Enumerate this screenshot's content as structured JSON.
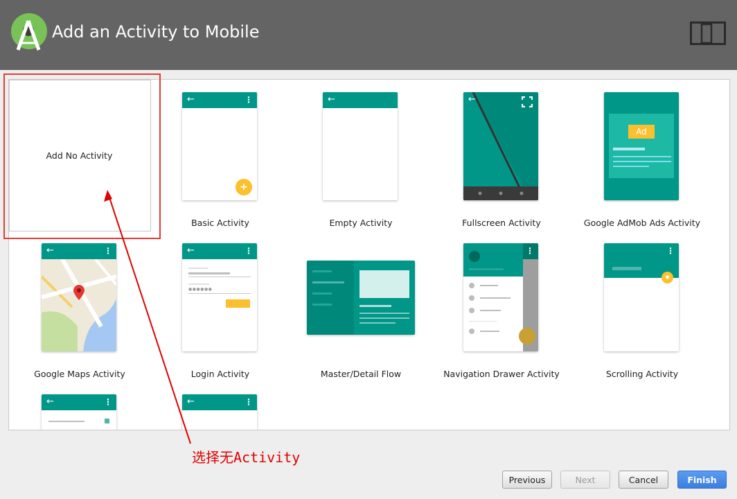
{
  "window": {
    "title": "Add an Activity to Mobile",
    "logo_icon": "android-studio-logo-icon",
    "device_icon": "tablet-phone-icon"
  },
  "templates": [
    {
      "label": "Add No Activity",
      "selected": true
    },
    {
      "label": "Basic Activity"
    },
    {
      "label": "Empty Activity"
    },
    {
      "label": "Fullscreen Activity"
    },
    {
      "label": "Google AdMob Ads Activity",
      "badge": "Ad"
    },
    {
      "label": "Google Maps Activity"
    },
    {
      "label": "Login Activity"
    },
    {
      "label": "Master/Detail Flow"
    },
    {
      "label": "Navigation Drawer Activity"
    },
    {
      "label": "Scrolling Activity"
    }
  ],
  "annotation": {
    "text": "选择无Activity",
    "color": "#e00000"
  },
  "buttons": {
    "previous": "Previous",
    "next": "Next",
    "cancel": "Cancel",
    "finish": "Finish"
  },
  "colors": {
    "header": "#646464",
    "teal": "#009688",
    "fab": "#fbc02d",
    "primary_button": "#3b7ee0",
    "selection": "#e53935"
  }
}
